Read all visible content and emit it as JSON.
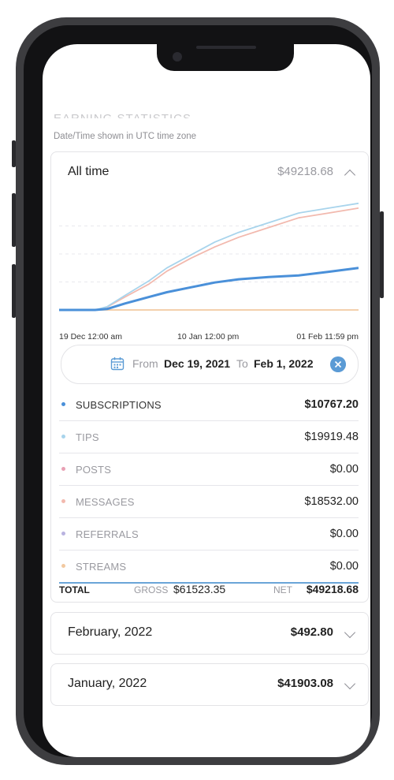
{
  "header": {
    "section_title": "EARNING STATISTICS",
    "timezone_note": "Date/Time shown in UTC time zone"
  },
  "summary": {
    "title": "All time",
    "total": "$49218.68"
  },
  "chart_data": {
    "type": "line",
    "x_ticks": [
      "19 Dec 12:00 am",
      "10 Jan 12:00 pm",
      "01 Feb 11:59 pm"
    ],
    "x": [
      0,
      0.08,
      0.12,
      0.16,
      0.22,
      0.3,
      0.36,
      0.44,
      0.52,
      0.6,
      0.7,
      0.8,
      0.9,
      1.0
    ],
    "series": [
      {
        "color": "#4a90d9",
        "values": [
          0,
          0,
          0,
          300,
          2000,
          4000,
          5500,
          7000,
          8500,
          9500,
          10200,
          10700,
          11800,
          13000
        ]
      },
      {
        "color": "#a8d4ec",
        "values": [
          0,
          0,
          0,
          1000,
          4500,
          9000,
          13000,
          17000,
          21000,
          24000,
          27000,
          30000,
          31500,
          33000
        ]
      },
      {
        "color": "#f2b9ae",
        "values": [
          0,
          0,
          0,
          900,
          4000,
          8000,
          12000,
          16000,
          19500,
          22500,
          25500,
          28500,
          30000,
          31500
        ]
      },
      {
        "color": "#f2c9a0",
        "values": [
          0,
          0,
          0,
          0,
          0,
          0,
          0,
          0,
          0,
          0,
          0,
          0,
          0,
          0
        ]
      }
    ],
    "grid": true,
    "legend": "none"
  },
  "date_range": {
    "from_label": "From",
    "from_value": "Dec 19, 2021",
    "to_label": "To",
    "to_value": "Feb 1, 2022"
  },
  "categories": [
    {
      "label": "SUBSCRIPTIONS",
      "amount": "$10767.20",
      "color": "#4a90d9"
    },
    {
      "label": "TIPS",
      "amount": "$19919.48",
      "color": "#a8d4ec"
    },
    {
      "label": "POSTS",
      "amount": "$0.00",
      "color": "#e8a0b4"
    },
    {
      "label": "MESSAGES",
      "amount": "$18532.00",
      "color": "#f2b9ae"
    },
    {
      "label": "REFERRALS",
      "amount": "$0.00",
      "color": "#b9b3e0"
    },
    {
      "label": "STREAMS",
      "amount": "$0.00",
      "color": "#f2c9a0"
    }
  ],
  "totals": {
    "label": "TOTAL",
    "gross_label": "GROSS",
    "gross_value": "$61523.35",
    "net_label": "NET",
    "net_value": "$49218.68"
  },
  "months": [
    {
      "name": "February, 2022",
      "amount": "$492.80"
    },
    {
      "name": "January, 2022",
      "amount": "$41903.08"
    }
  ],
  "colors": {
    "accent": "#5b9bd5",
    "muted_text": "#9a9aa0",
    "divider": "#e6e6ea"
  }
}
